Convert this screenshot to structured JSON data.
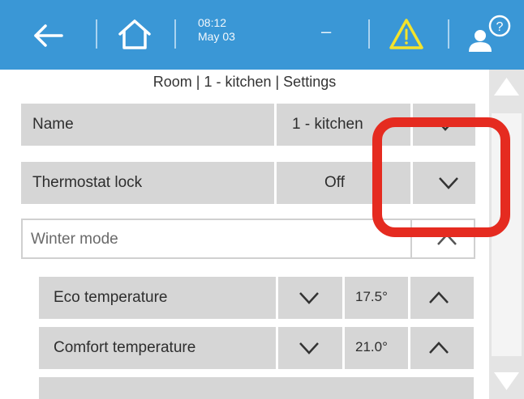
{
  "topbar": {
    "time": "08:12",
    "date": "May 03",
    "status_dash": "–"
  },
  "page": {
    "title": "Room | 1 - kitchen | Settings"
  },
  "rows": {
    "name": {
      "label": "Name",
      "value": "1 - kitchen"
    },
    "thermostat_lock": {
      "label": "Thermostat lock",
      "value": "Off"
    },
    "winter_mode": {
      "label": "Winter mode"
    },
    "eco_temperature": {
      "label": "Eco temperature",
      "value": "17.5°"
    },
    "comfort_temperature": {
      "label": "Comfort temperature",
      "value": "21.0°"
    }
  },
  "colors": {
    "topbar": "#3a97d6",
    "row_background": "#d6d6d6",
    "highlight": "#e52b20",
    "warning": "#f4e32b"
  }
}
